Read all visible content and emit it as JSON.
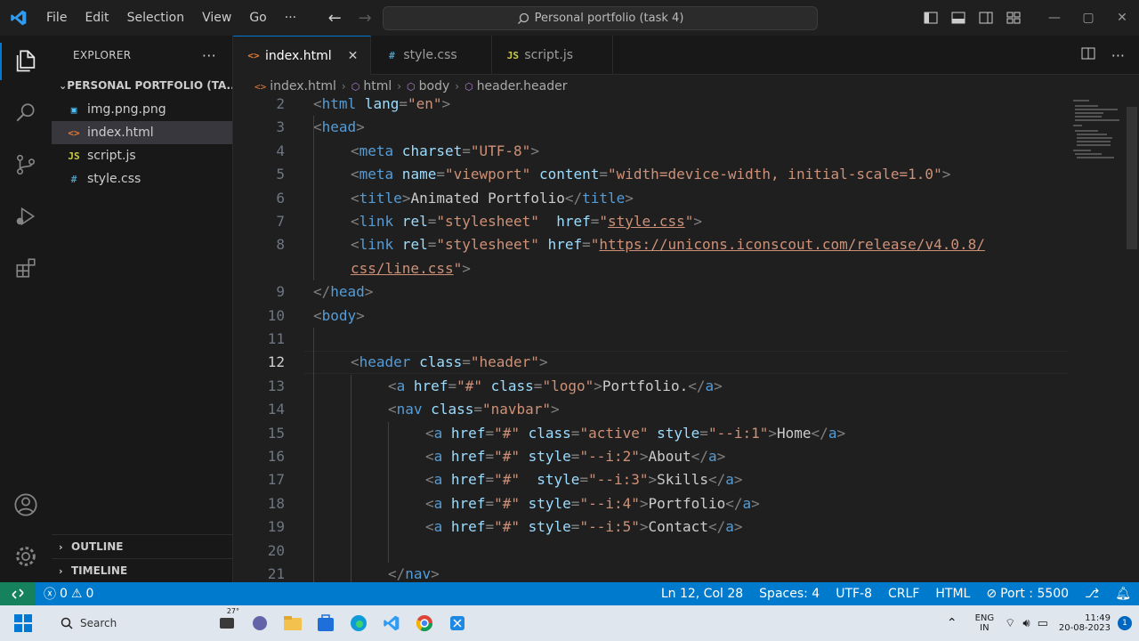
{
  "titlebar": {
    "menu": [
      "File",
      "Edit",
      "Selection",
      "View",
      "Go",
      "···"
    ],
    "command_center": "Personal portfolio (task 4)"
  },
  "sidebar": {
    "title": "EXPLORER",
    "more": "···",
    "folder": "PERSONAL PORTFOLIO (TA...",
    "files": [
      {
        "name": "img.png.png",
        "icon": "image-icon",
        "glyph": "▣",
        "color": "#4fc1ff"
      },
      {
        "name": "index.html",
        "icon": "html-icon",
        "glyph": "<>",
        "color": "#e37933"
      },
      {
        "name": "script.js",
        "icon": "js-icon",
        "glyph": "JS",
        "color": "#cbcb41"
      },
      {
        "name": "style.css",
        "icon": "css-icon",
        "glyph": "#",
        "color": "#519aba"
      }
    ],
    "outline": "OUTLINE",
    "timeline": "TIMELINE"
  },
  "tabs": [
    {
      "label": "index.html",
      "glyph": "<>",
      "color": "#e37933",
      "close": "✕"
    },
    {
      "label": "style.css",
      "glyph": "#",
      "color": "#519aba"
    },
    {
      "label": "script.js",
      "glyph": "JS",
      "color": "#cbcb41"
    }
  ],
  "breadcrumb": [
    "index.html",
    "html",
    "body",
    "header.header"
  ],
  "editor": {
    "current_line": 12,
    "lines": [
      {
        "n": "2",
        "indent": 0,
        "tokens": [
          [
            "br",
            "<"
          ],
          [
            "tag",
            "html"
          ],
          [
            "at",
            " lang"
          ],
          [
            "br",
            "="
          ],
          [
            "str",
            "\"en\""
          ],
          [
            "br",
            ">"
          ]
        ]
      },
      {
        "n": "3",
        "indent": 0,
        "tokens": [
          [
            "br",
            "<"
          ],
          [
            "tag",
            "head"
          ],
          [
            "br",
            ">"
          ]
        ]
      },
      {
        "n": "4",
        "indent": 1,
        "tokens": [
          [
            "br",
            "<"
          ],
          [
            "tag",
            "meta"
          ],
          [
            "at",
            " charset"
          ],
          [
            "br",
            "="
          ],
          [
            "str",
            "\"UTF-8\""
          ],
          [
            "br",
            ">"
          ]
        ]
      },
      {
        "n": "5",
        "indent": 1,
        "tokens": [
          [
            "br",
            "<"
          ],
          [
            "tag",
            "meta"
          ],
          [
            "at",
            " name"
          ],
          [
            "br",
            "="
          ],
          [
            "str",
            "\"viewport\""
          ],
          [
            "at",
            " content"
          ],
          [
            "br",
            "="
          ],
          [
            "str",
            "\"width=device-width, initial-scale=1.0\""
          ],
          [
            "br",
            ">"
          ]
        ]
      },
      {
        "n": "6",
        "indent": 1,
        "tokens": [
          [
            "br",
            "<"
          ],
          [
            "tag",
            "title"
          ],
          [
            "br",
            ">"
          ],
          [
            "txt",
            "Animated Portfolio"
          ],
          [
            "br",
            "</"
          ],
          [
            "tag",
            "title"
          ],
          [
            "br",
            ">"
          ]
        ]
      },
      {
        "n": "7",
        "indent": 1,
        "tokens": [
          [
            "br",
            "<"
          ],
          [
            "tag",
            "link"
          ],
          [
            "at",
            " rel"
          ],
          [
            "br",
            "="
          ],
          [
            "str",
            "\"stylesheet\""
          ],
          [
            "at",
            "  href"
          ],
          [
            "br",
            "="
          ],
          [
            "str",
            "\""
          ],
          [
            "link",
            "style.css"
          ],
          [
            "str",
            "\""
          ],
          [
            "br",
            ">"
          ]
        ]
      },
      {
        "n": "8",
        "indent": 1,
        "tokens": [
          [
            "br",
            "<"
          ],
          [
            "tag",
            "link"
          ],
          [
            "at",
            " rel"
          ],
          [
            "br",
            "="
          ],
          [
            "str",
            "\"stylesheet\""
          ],
          [
            "at",
            " href"
          ],
          [
            "br",
            "="
          ],
          [
            "str",
            "\""
          ],
          [
            "link",
            "https://unicons.iconscout.com/release/v4.0.8/"
          ]
        ]
      },
      {
        "n": "",
        "indent": 1,
        "tokens": [
          [
            "link",
            "css/line.css"
          ],
          [
            "str",
            "\""
          ],
          [
            "br",
            ">"
          ]
        ]
      },
      {
        "n": "9",
        "indent": 0,
        "tokens": [
          [
            "br",
            "</"
          ],
          [
            "tag",
            "head"
          ],
          [
            "br",
            ">"
          ]
        ]
      },
      {
        "n": "10",
        "indent": 0,
        "tokens": [
          [
            "br",
            "<"
          ],
          [
            "tag",
            "body"
          ],
          [
            "br",
            ">"
          ]
        ]
      },
      {
        "n": "11",
        "indent": 0,
        "tokens": []
      },
      {
        "n": "12",
        "indent": 1,
        "tokens": [
          [
            "br",
            "<"
          ],
          [
            "tag",
            "header"
          ],
          [
            "at",
            " class"
          ],
          [
            "br",
            "="
          ],
          [
            "str",
            "\"header\""
          ],
          [
            "br",
            ">"
          ]
        ]
      },
      {
        "n": "13",
        "indent": 2,
        "tokens": [
          [
            "br",
            "<"
          ],
          [
            "tag",
            "a"
          ],
          [
            "at",
            " href"
          ],
          [
            "br",
            "="
          ],
          [
            "str",
            "\"#\""
          ],
          [
            "at",
            " class"
          ],
          [
            "br",
            "="
          ],
          [
            "str",
            "\"logo\""
          ],
          [
            "br",
            ">"
          ],
          [
            "txt",
            "Portfolio."
          ],
          [
            "br",
            "</"
          ],
          [
            "tag",
            "a"
          ],
          [
            "br",
            ">"
          ]
        ]
      },
      {
        "n": "14",
        "indent": 2,
        "tokens": [
          [
            "br",
            "<"
          ],
          [
            "tag",
            "nav"
          ],
          [
            "at",
            " class"
          ],
          [
            "br",
            "="
          ],
          [
            "str",
            "\"navbar\""
          ],
          [
            "br",
            ">"
          ]
        ]
      },
      {
        "n": "15",
        "indent": 3,
        "tokens": [
          [
            "br",
            "<"
          ],
          [
            "tag",
            "a"
          ],
          [
            "at",
            " href"
          ],
          [
            "br",
            "="
          ],
          [
            "str",
            "\"#\""
          ],
          [
            "at",
            " class"
          ],
          [
            "br",
            "="
          ],
          [
            "str",
            "\"active\""
          ],
          [
            "at",
            " style"
          ],
          [
            "br",
            "="
          ],
          [
            "str",
            "\"--i:1\""
          ],
          [
            "br",
            ">"
          ],
          [
            "txt",
            "Home"
          ],
          [
            "br",
            "</"
          ],
          [
            "tag",
            "a"
          ],
          [
            "br",
            ">"
          ]
        ]
      },
      {
        "n": "16",
        "indent": 3,
        "tokens": [
          [
            "br",
            "<"
          ],
          [
            "tag",
            "a"
          ],
          [
            "at",
            " href"
          ],
          [
            "br",
            "="
          ],
          [
            "str",
            "\"#\""
          ],
          [
            "at",
            " style"
          ],
          [
            "br",
            "="
          ],
          [
            "str",
            "\"--i:2\""
          ],
          [
            "br",
            ">"
          ],
          [
            "txt",
            "About"
          ],
          [
            "br",
            "</"
          ],
          [
            "tag",
            "a"
          ],
          [
            "br",
            ">"
          ]
        ]
      },
      {
        "n": "17",
        "indent": 3,
        "tokens": [
          [
            "br",
            "<"
          ],
          [
            "tag",
            "a"
          ],
          [
            "at",
            " href"
          ],
          [
            "br",
            "="
          ],
          [
            "str",
            "\"#\""
          ],
          [
            "at",
            "  style"
          ],
          [
            "br",
            "="
          ],
          [
            "str",
            "\"--i:3\""
          ],
          [
            "br",
            ">"
          ],
          [
            "txt",
            "Skills"
          ],
          [
            "br",
            "</"
          ],
          [
            "tag",
            "a"
          ],
          [
            "br",
            ">"
          ]
        ]
      },
      {
        "n": "18",
        "indent": 3,
        "tokens": [
          [
            "br",
            "<"
          ],
          [
            "tag",
            "a"
          ],
          [
            "at",
            " href"
          ],
          [
            "br",
            "="
          ],
          [
            "str",
            "\"#\""
          ],
          [
            "at",
            " style"
          ],
          [
            "br",
            "="
          ],
          [
            "str",
            "\"--i:4\""
          ],
          [
            "br",
            ">"
          ],
          [
            "txt",
            "Portfolio"
          ],
          [
            "br",
            "</"
          ],
          [
            "tag",
            "a"
          ],
          [
            "br",
            ">"
          ]
        ]
      },
      {
        "n": "19",
        "indent": 3,
        "tokens": [
          [
            "br",
            "<"
          ],
          [
            "tag",
            "a"
          ],
          [
            "at",
            " href"
          ],
          [
            "br",
            "="
          ],
          [
            "str",
            "\"#\""
          ],
          [
            "at",
            " style"
          ],
          [
            "br",
            "="
          ],
          [
            "str",
            "\"--i:5\""
          ],
          [
            "br",
            ">"
          ],
          [
            "txt",
            "Contact"
          ],
          [
            "br",
            "</"
          ],
          [
            "tag",
            "a"
          ],
          [
            "br",
            ">"
          ]
        ]
      },
      {
        "n": "20",
        "indent": 0,
        "tokens": []
      },
      {
        "n": "21",
        "indent": 2,
        "tokens": [
          [
            "br",
            "</"
          ],
          [
            "tag",
            "nav"
          ],
          [
            "br",
            ">"
          ]
        ]
      }
    ]
  },
  "statusbar": {
    "errors": "0",
    "warnings": "0",
    "position": "Ln 12, Col 28",
    "spaces": "Spaces: 4",
    "encoding": "UTF-8",
    "eol": "CRLF",
    "language": "HTML",
    "port": "Port : 5500"
  },
  "taskbar": {
    "search": "Search",
    "weather": "27°",
    "lang_top": "ENG",
    "lang_bottom": "IN",
    "time": "11:49",
    "date": "20-08-2023",
    "notification_count": "1"
  }
}
